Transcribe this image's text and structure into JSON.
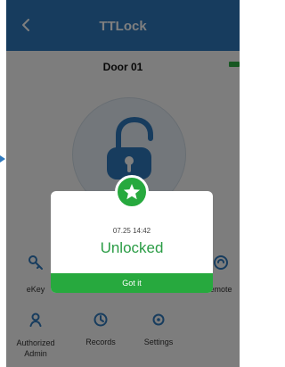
{
  "header": {
    "title": "TTLock"
  },
  "door": {
    "name": "Door 01"
  },
  "actions": {
    "ekey": "eKey",
    "remote": "emote",
    "authorized_admin": "Authorized Admin",
    "records": "Records",
    "settings": "Settings"
  },
  "modal": {
    "time": "07.25 14:42",
    "status": "Unlocked",
    "button": "Got it"
  },
  "colors": {
    "header": "#2f79bd",
    "accent_green": "#27a93e",
    "status_text_green": "#2a9c45"
  },
  "icons": [
    "back-arrow-icon",
    "battery-icon",
    "unlocked-padlock-icon",
    "star-icon",
    "key-icon",
    "remote-icon",
    "authorized-admin-icon",
    "records-icon",
    "settings-icon",
    "left-arrow-icon"
  ]
}
